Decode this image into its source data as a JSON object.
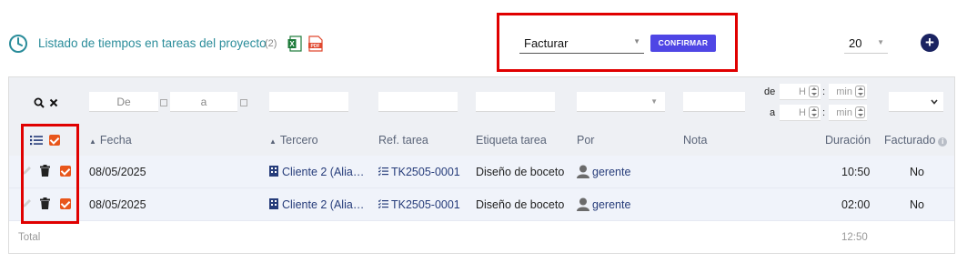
{
  "header": {
    "title": "Listado de tiempos en tareas del proyecto",
    "count": "(2)"
  },
  "mass_action": {
    "selected": "Facturar",
    "confirm_label": "CONFIRMAR"
  },
  "pagination": {
    "limit": "20"
  },
  "filters": {
    "date_from_placeholder": "De",
    "date_to_placeholder": "a",
    "duration_from_label": "de",
    "duration_to_label": "a",
    "hour_placeholder": "H",
    "minute_placeholder": "min",
    "colon": ":"
  },
  "columns": {
    "fecha": "Fecha",
    "tercero": "Tercero",
    "ref_tarea": "Ref. tarea",
    "etiqueta_tarea": "Etiqueta tarea",
    "por": "Por",
    "nota": "Nota",
    "duracion": "Duración",
    "facturado": "Facturado"
  },
  "rows": [
    {
      "fecha": "08/05/2025",
      "tercero": "Cliente 2 (Alia…",
      "ref_tarea": "TK2505-0001",
      "etiqueta": "Diseño de boceto",
      "por": "gerente",
      "nota": "",
      "duracion": "10:50",
      "facturado": "No"
    },
    {
      "fecha": "08/05/2025",
      "tercero": "Cliente 2 (Alia…",
      "ref_tarea": "TK2505-0001",
      "etiqueta": "Diseño de boceto",
      "por": "gerente",
      "nota": "",
      "duracion": "02:00",
      "facturado": "No"
    }
  ],
  "totals": {
    "label": "Total",
    "duracion": "12:50"
  },
  "colors": {
    "accent": "#4f46e5",
    "title": "#2a8c9a",
    "highlight": "#e00000",
    "checkbox": "#e8561b",
    "link": "#263c7a"
  }
}
